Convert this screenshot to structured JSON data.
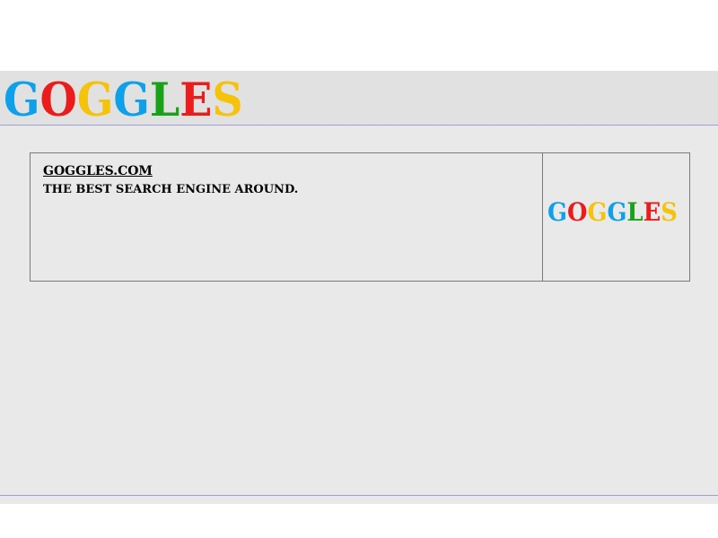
{
  "logo": {
    "letters": [
      "G",
      "O",
      "G",
      "G",
      "L",
      "E",
      "S"
    ],
    "colors": [
      "#0ea0e8",
      "#ea1c1c",
      "#f5c20c",
      "#0ea0e8",
      "#1aa11a",
      "#ea1c1c",
      "#f5c20c"
    ]
  },
  "result": {
    "title": "GOGGLES.COM",
    "description": "THE BEST SEARCH ENGINE AROUND.",
    "thumbnail_letters": [
      "G",
      "O",
      "G",
      "G",
      "L",
      "E",
      "S"
    ],
    "thumbnail_colors": [
      "#0ea0e8",
      "#ea1c1c",
      "#f5c20c",
      "#0ea0e8",
      "#1aa11a",
      "#ea1c1c",
      "#f5c20c"
    ]
  },
  "colors": {
    "header_bg": "#e1e1e1",
    "main_bg": "#e9e9e9",
    "divider": "#9f9fd8",
    "card_border": "#7a7a7a"
  }
}
